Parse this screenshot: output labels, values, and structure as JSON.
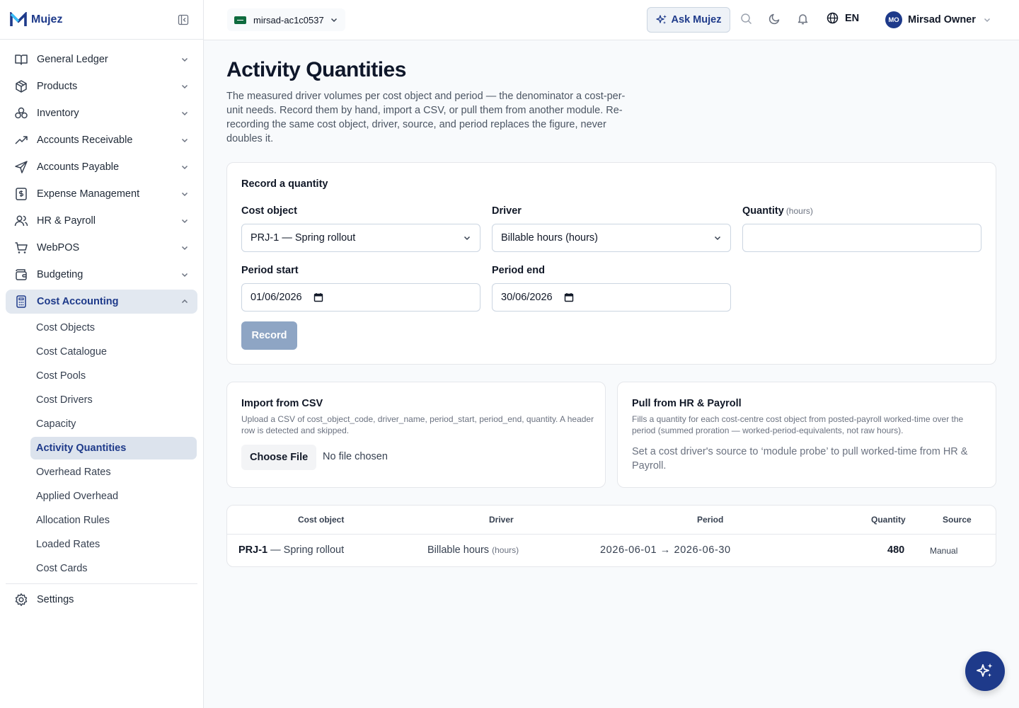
{
  "brand": {
    "name": "Mujez"
  },
  "sidebar": {
    "items": [
      {
        "label": "General Ledger",
        "icon": "book-open-icon"
      },
      {
        "label": "Products",
        "icon": "package-icon"
      },
      {
        "label": "Inventory",
        "icon": "boxes-icon"
      },
      {
        "label": "Accounts Receivable",
        "icon": "trending-up-icon"
      },
      {
        "label": "Accounts Payable",
        "icon": "send-icon"
      },
      {
        "label": "Expense Management",
        "icon": "receipt-icon"
      },
      {
        "label": "HR & Payroll",
        "icon": "users-icon"
      },
      {
        "label": "WebPOS",
        "icon": "cart-icon"
      },
      {
        "label": "Budgeting",
        "icon": "wallet-icon"
      },
      {
        "label": "Cost Accounting",
        "icon": "calculator-icon"
      }
    ],
    "sub_items": [
      "Cost Objects",
      "Cost Catalogue",
      "Cost Pools",
      "Cost Drivers",
      "Capacity",
      "Activity Quantities",
      "Overhead Rates",
      "Applied Overhead",
      "Allocation Rules",
      "Loaded Rates",
      "Cost Cards"
    ],
    "active_sub": "Activity Quantities",
    "settings_label": "Settings"
  },
  "topbar": {
    "tenant": "mirsad-ac1c0537",
    "ask_label": "Ask Mujez",
    "language": "EN",
    "user_initials": "MO",
    "user_name": "Mirsad Owner"
  },
  "page": {
    "title": "Activity Quantities",
    "description": "The measured driver volumes per cost object and period — the denominator a cost-per-unit needs. Record them by hand, import a CSV, or pull them from another module. Re-recording the same cost object, driver, source, and period replaces the figure, never doubles it."
  },
  "record": {
    "title": "Record a quantity",
    "cost_object_label": "Cost object",
    "cost_object_value": "PRJ-1 — Spring rollout",
    "driver_label": "Driver",
    "driver_value": "Billable hours (hours)",
    "quantity_label": "Quantity",
    "quantity_unit": "(hours)",
    "quantity_value": "",
    "period_start_label": "Period start",
    "period_start_value": "01/06/2026",
    "period_end_label": "Period end",
    "period_end_value": "30/06/2026",
    "button": "Record"
  },
  "csv": {
    "title": "Import from CSV",
    "note": "Upload a CSV of cost_object_code, driver_name, period_start, period_end, quantity. A header row is detected and skipped.",
    "choose_label": "Choose File",
    "no_file": "No file chosen"
  },
  "hr": {
    "title": "Pull from HR & Payroll",
    "note": "Fills a quantity for each cost-centre cost object from posted-payroll worked-time over the period (summed proration — worked-period-equivalents, not raw hours).",
    "text": "Set a cost driver's source to ‘module probe’ to pull worked-time from HR & Payroll."
  },
  "table": {
    "headers": [
      "Cost object",
      "Driver",
      "Period",
      "Quantity",
      "Source"
    ],
    "rows": [
      {
        "code": "PRJ-1",
        "name": "— Spring rollout",
        "driver": "Billable hours",
        "driver_unit": "(hours)",
        "period": "2026-06-01 → 2026-06-30",
        "quantity": "480",
        "source": "Manual"
      }
    ]
  },
  "colors": {
    "primary": "#1e3a8a",
    "active_bg": "#e2e8f0",
    "record_button": "#8ea5c4"
  }
}
